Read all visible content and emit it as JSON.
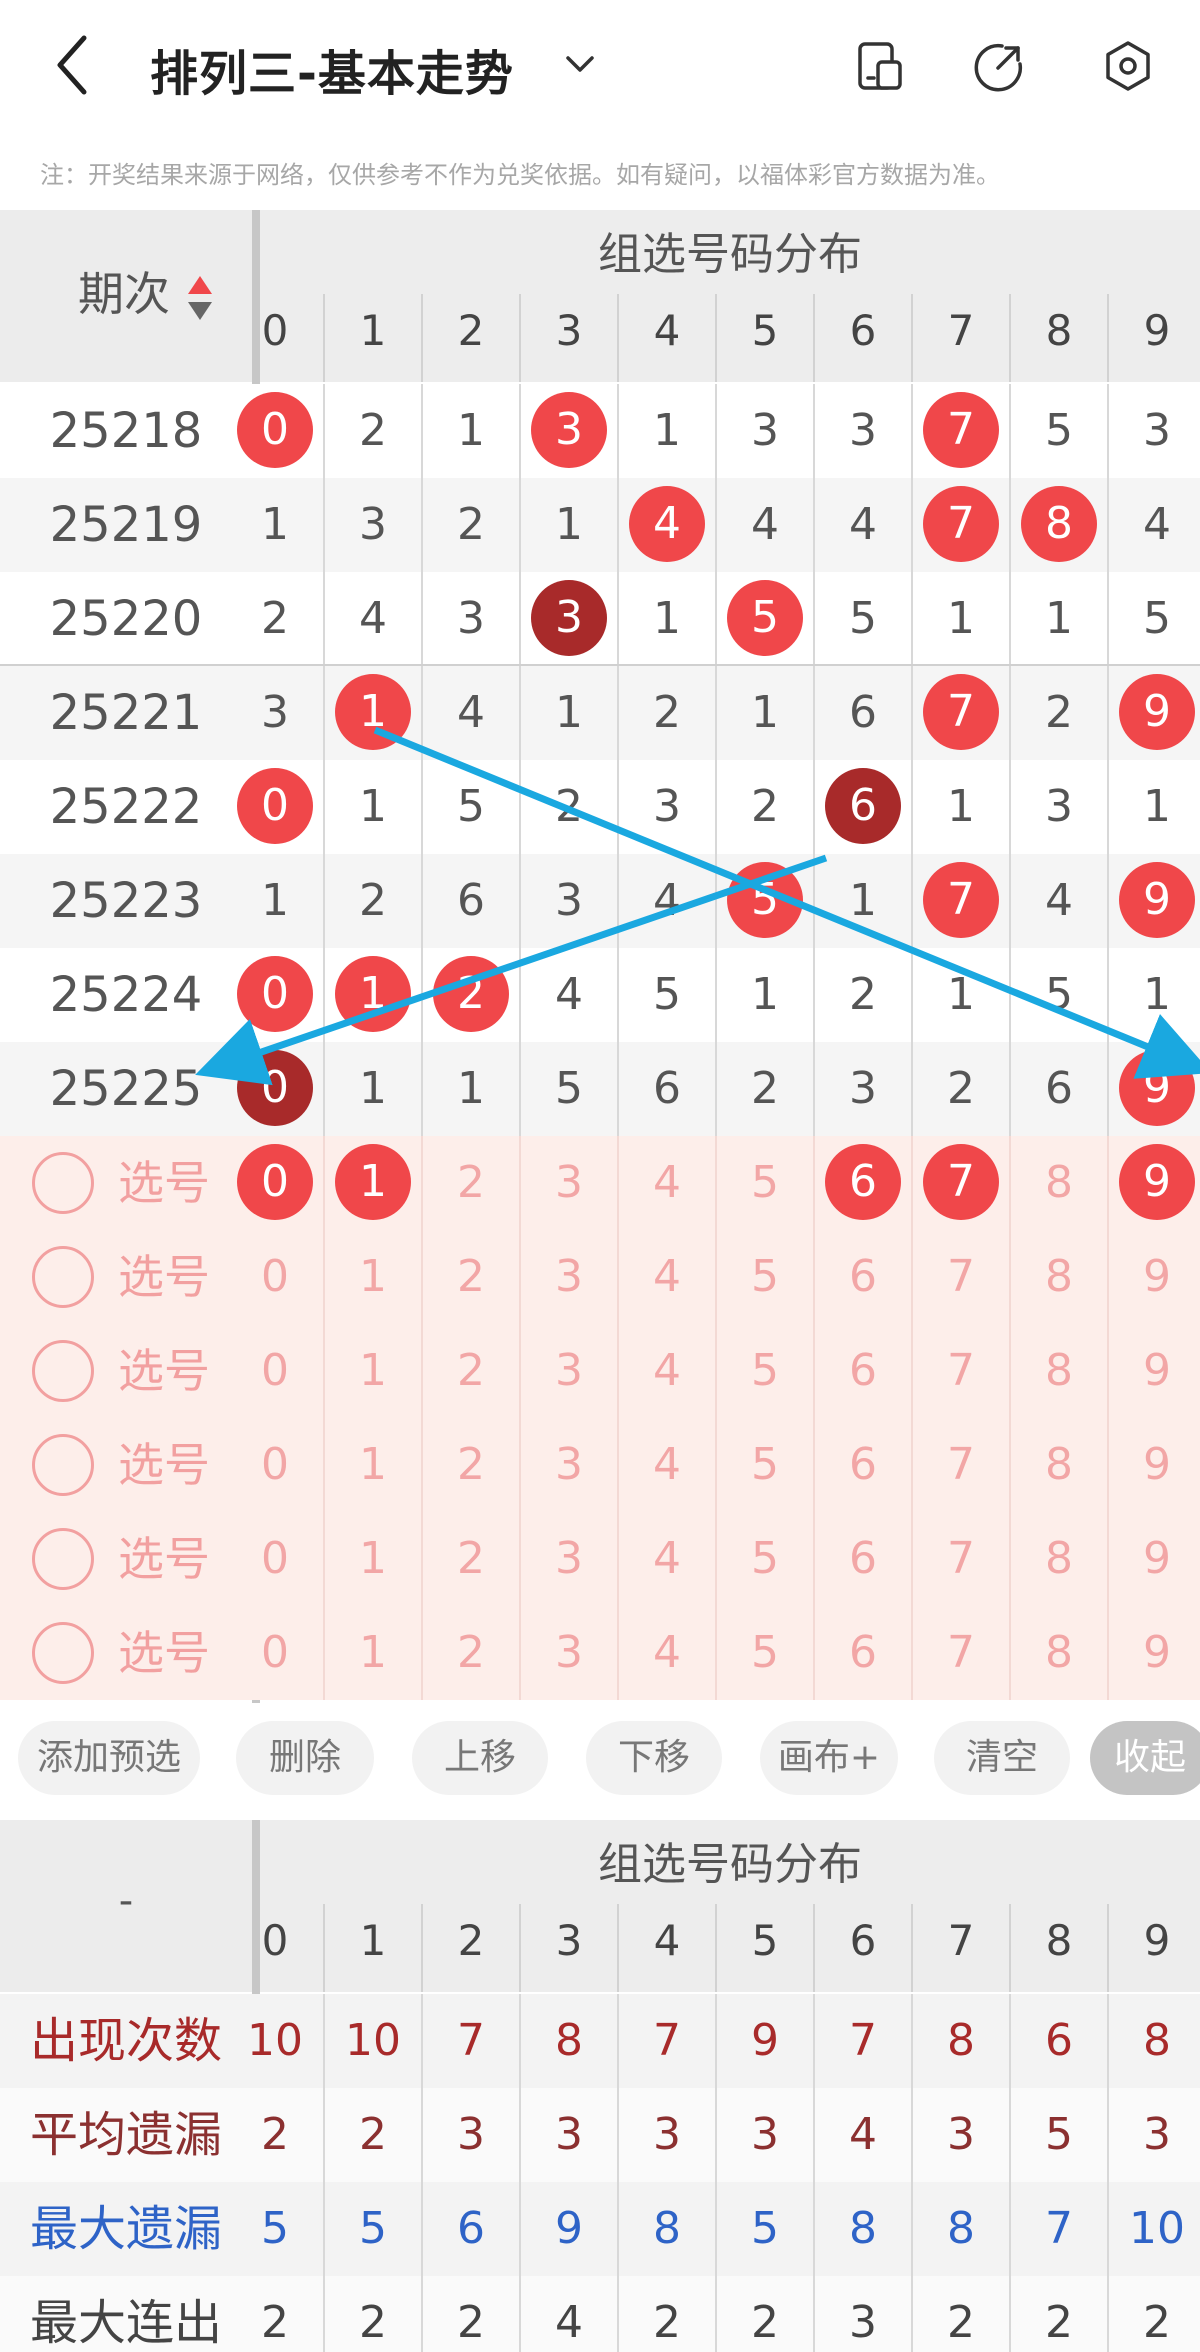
{
  "header": {
    "title": "排列三-基本走势",
    "notice": "注：开奖结果来源于网络，仅供参考不作为兑奖依据。如有疑问，以福体彩官方数据为准。"
  },
  "table": {
    "period_header": "期次",
    "section_title": "组选号码分布",
    "columns": [
      "0",
      "1",
      "2",
      "3",
      "4",
      "5",
      "6",
      "7",
      "8",
      "9"
    ],
    "rows": [
      {
        "period": "25218",
        "cells": [
          {
            "v": "0",
            "s": "red"
          },
          {
            "v": "2"
          },
          {
            "v": "1"
          },
          {
            "v": "3",
            "s": "red"
          },
          {
            "v": "1"
          },
          {
            "v": "3"
          },
          {
            "v": "3"
          },
          {
            "v": "7",
            "s": "red"
          },
          {
            "v": "5"
          },
          {
            "v": "3"
          }
        ]
      },
      {
        "period": "25219",
        "cells": [
          {
            "v": "1"
          },
          {
            "v": "3"
          },
          {
            "v": "2"
          },
          {
            "v": "1"
          },
          {
            "v": "4",
            "s": "red"
          },
          {
            "v": "4"
          },
          {
            "v": "4"
          },
          {
            "v": "7",
            "s": "red"
          },
          {
            "v": "8",
            "s": "red"
          },
          {
            "v": "4"
          }
        ]
      },
      {
        "period": "25220",
        "cells": [
          {
            "v": "2"
          },
          {
            "v": "4"
          },
          {
            "v": "3"
          },
          {
            "v": "3",
            "s": "dark"
          },
          {
            "v": "1"
          },
          {
            "v": "5",
            "s": "red"
          },
          {
            "v": "5"
          },
          {
            "v": "1"
          },
          {
            "v": "1"
          },
          {
            "v": "5"
          }
        ]
      },
      {
        "period": "25221",
        "cells": [
          {
            "v": "3"
          },
          {
            "v": "1",
            "s": "red"
          },
          {
            "v": "4"
          },
          {
            "v": "1"
          },
          {
            "v": "2"
          },
          {
            "v": "1"
          },
          {
            "v": "6"
          },
          {
            "v": "7",
            "s": "red"
          },
          {
            "v": "2"
          },
          {
            "v": "9",
            "s": "red"
          }
        ]
      },
      {
        "period": "25222",
        "cells": [
          {
            "v": "0",
            "s": "red"
          },
          {
            "v": "1"
          },
          {
            "v": "5"
          },
          {
            "v": "2"
          },
          {
            "v": "3"
          },
          {
            "v": "2"
          },
          {
            "v": "6",
            "s": "dark"
          },
          {
            "v": "1"
          },
          {
            "v": "3"
          },
          {
            "v": "1"
          }
        ]
      },
      {
        "period": "25223",
        "cells": [
          {
            "v": "1"
          },
          {
            "v": "2"
          },
          {
            "v": "6"
          },
          {
            "v": "3"
          },
          {
            "v": "4"
          },
          {
            "v": "5",
            "s": "red"
          },
          {
            "v": "1"
          },
          {
            "v": "7",
            "s": "red"
          },
          {
            "v": "4"
          },
          {
            "v": "9",
            "s": "red"
          }
        ]
      },
      {
        "period": "25224",
        "cells": [
          {
            "v": "0",
            "s": "red"
          },
          {
            "v": "1",
            "s": "red"
          },
          {
            "v": "2",
            "s": "red"
          },
          {
            "v": "4"
          },
          {
            "v": "5"
          },
          {
            "v": "1"
          },
          {
            "v": "2"
          },
          {
            "v": "1"
          },
          {
            "v": "5"
          },
          {
            "v": "1"
          }
        ]
      },
      {
        "period": "25225",
        "cells": [
          {
            "v": "0",
            "s": "dark"
          },
          {
            "v": "1"
          },
          {
            "v": "1"
          },
          {
            "v": "5"
          },
          {
            "v": "6"
          },
          {
            "v": "2"
          },
          {
            "v": "3"
          },
          {
            "v": "2"
          },
          {
            "v": "6"
          },
          {
            "v": "9",
            "s": "red"
          }
        ]
      }
    ],
    "select_label": "选号",
    "select_rows": [
      {
        "selected": [
          "0",
          "1",
          "6",
          "7",
          "9"
        ]
      },
      {
        "selected": []
      },
      {
        "selected": []
      },
      {
        "selected": []
      },
      {
        "selected": []
      },
      {
        "selected": []
      }
    ]
  },
  "toolbar": {
    "buttons": [
      "添加预选",
      "删除",
      "上移",
      "下移",
      "画布+",
      "清空",
      "收起"
    ]
  },
  "stats": {
    "corner": "-",
    "section_title": "组选号码分布",
    "columns": [
      "0",
      "1",
      "2",
      "3",
      "4",
      "5",
      "6",
      "7",
      "8",
      "9"
    ],
    "rows": [
      {
        "label": "出现次数",
        "color": "#a82a2a",
        "values": [
          "10",
          "10",
          "7",
          "8",
          "7",
          "9",
          "7",
          "8",
          "6",
          "8"
        ]
      },
      {
        "label": "平均遗漏",
        "color": "#8b3030",
        "values": [
          "2",
          "2",
          "3",
          "3",
          "3",
          "3",
          "4",
          "3",
          "5",
          "3"
        ]
      },
      {
        "label": "最大遗漏",
        "color": "#2e63c7",
        "values": [
          "5",
          "5",
          "6",
          "9",
          "8",
          "5",
          "8",
          "8",
          "7",
          "10"
        ]
      },
      {
        "label": "最大连出",
        "color": "#444444",
        "values": [
          "2",
          "2",
          "2",
          "4",
          "2",
          "2",
          "3",
          "2",
          "2",
          "2"
        ]
      }
    ]
  },
  "colors": {
    "ball_red": "#f0474a",
    "ball_dark": "#a82a2a",
    "trend_line": "#1aa8e0",
    "select_bg": "#fdeeea"
  }
}
